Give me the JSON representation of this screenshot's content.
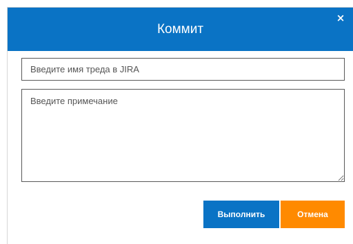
{
  "dialog": {
    "title": "Коммит",
    "close_label": "×"
  },
  "form": {
    "thread_placeholder": "Введите имя треда в JIRA",
    "thread_value": "",
    "note_placeholder": "Введите примечание",
    "note_value": ""
  },
  "actions": {
    "execute_label": "Выполнить",
    "cancel_label": "Отмена"
  },
  "colors": {
    "header": "#0a73c5",
    "execute_button": "#0a73c5",
    "cancel_button": "#ff8a00"
  }
}
